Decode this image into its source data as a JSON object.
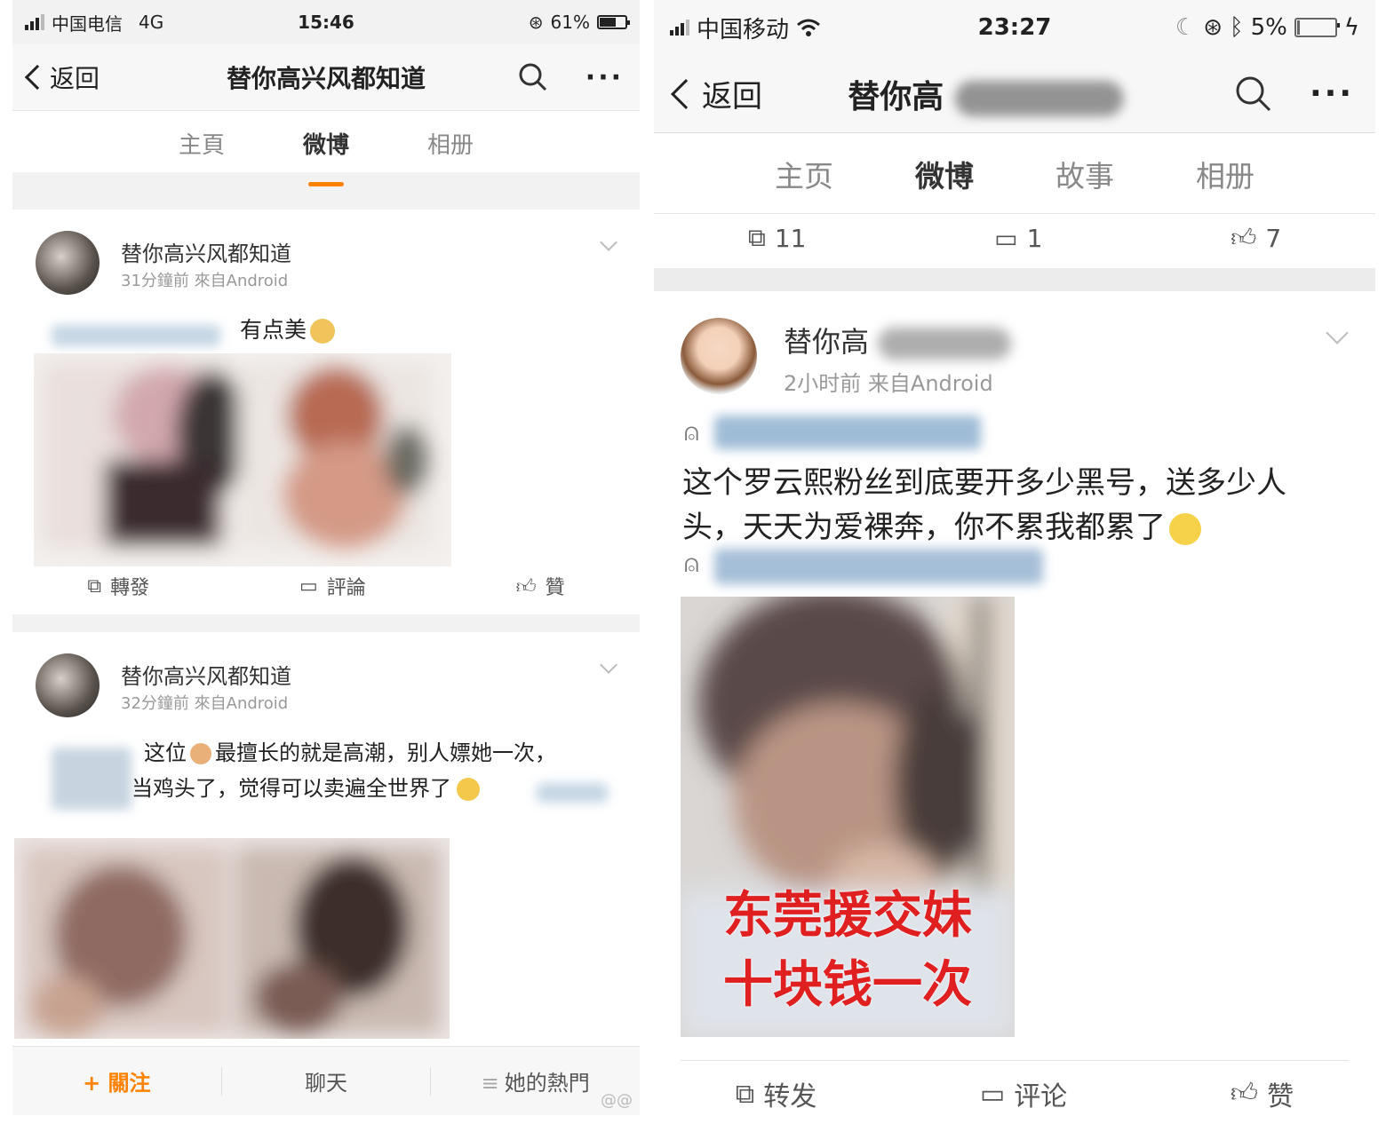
{
  "left": {
    "status": {
      "carrier": "中国电信",
      "network": "4G",
      "time": "15:46",
      "battery": "61%",
      "battery_level": 0.61
    },
    "nav": {
      "back": "返回",
      "title": "替你高兴风都知道"
    },
    "tabs": [
      "主頁",
      "微博",
      "相册"
    ],
    "posts": [
      {
        "author": "替你高兴风都知道",
        "meta": "31分鐘前  來自Android",
        "text": "有点美",
        "actions": [
          "轉發",
          "評論",
          "贊"
        ]
      },
      {
        "author": "替你高兴风都知道",
        "meta": "32分鐘前  來自Android",
        "text_line1": "这位",
        "text_line1b": "最擅长的就是高潮，别人嫖她一次，",
        "text_line2": "当鸡头了，觉得可以卖遍全世界了"
      }
    ],
    "bottom": {
      "follow": "+ 關注",
      "chat": "聊天",
      "hot": "她的熱門"
    },
    "watermark": "@@"
  },
  "right": {
    "status": {
      "carrier": "中国移动",
      "time": "23:27",
      "battery": "5%",
      "battery_level": 0.05
    },
    "nav": {
      "back": "返回",
      "title": "替你高"
    },
    "tabs": [
      "主页",
      "微博",
      "故事",
      "相册"
    ],
    "counts": {
      "repost": "11",
      "comment": "1",
      "like": "7"
    },
    "post": {
      "author": "替你高",
      "meta": "2小时前  来自Android",
      "text_line1": "这个罗云熙粉丝到底要开多少黑号，送多少人",
      "text_line2": "头，天天为爱裸奔，你不累我都累了",
      "image_caption_1": "东莞援交妹",
      "image_caption_2": "十块钱一次",
      "actions": [
        "转发",
        "评论",
        "赞"
      ]
    }
  }
}
